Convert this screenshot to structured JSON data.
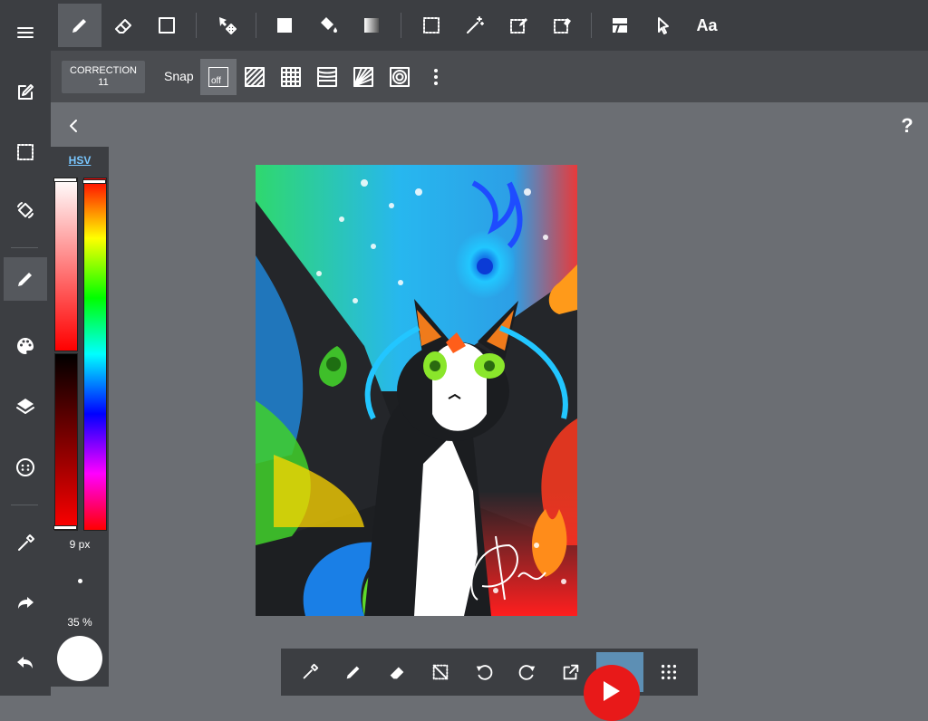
{
  "top_toolbar": {
    "tools": [
      "brush",
      "eraser",
      "shape",
      "move",
      "fill-rect",
      "bucket-fill",
      "gradient",
      "select",
      "magic-wand",
      "select-pen",
      "select-eraser",
      "frame-divider",
      "operation",
      "text"
    ],
    "active_tool": "brush",
    "text_tool_label": "Aa"
  },
  "sub_toolbar": {
    "correction_label": "CORRECTION",
    "correction_value": "11",
    "snap_label": "Snap",
    "snap_off_label": "off",
    "active_snap": "off"
  },
  "help_label": "?",
  "left_sidebar": {
    "items": [
      "menu",
      "edit",
      "selection",
      "transform",
      "brush",
      "color",
      "layers",
      "materials",
      "eyedropper",
      "redo",
      "undo"
    ],
    "active_item": "brush"
  },
  "color_panel": {
    "mode_label": "HSV",
    "brush_size": "9 px",
    "opacity": "35 %",
    "current_color": "#ffffff",
    "saturation_level": 0.01,
    "value_level": 0.99,
    "hue_level": 0.01
  },
  "bottom_toolbar": {
    "tools": [
      "eyedropper",
      "pen",
      "eraser",
      "clear-selection",
      "undo",
      "redo",
      "export",
      "layer",
      "grid-menu"
    ],
    "active_tool": "layer"
  },
  "colors": {
    "panel_bg": "#3c3e42",
    "workspace_bg": "#6b6e73",
    "accent": "#79c7ff",
    "youtube_red": "#e81919"
  }
}
